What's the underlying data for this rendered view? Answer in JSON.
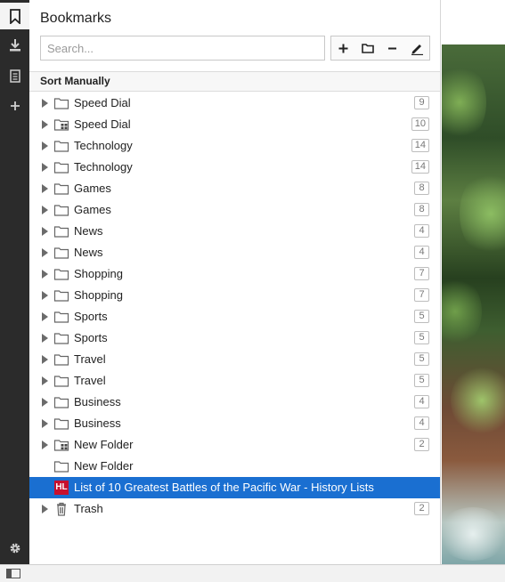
{
  "panel": {
    "title": "Bookmarks",
    "search_placeholder": "Search...",
    "sort_label": "Sort Manually"
  },
  "toolbar": {
    "add": "+",
    "minus": "−"
  },
  "strip": {
    "icons": [
      "bookmark-icon",
      "download-icon",
      "notes-icon",
      "add-panel-icon",
      "settings-icon"
    ]
  },
  "items": [
    {
      "label": "Speed Dial",
      "count": "9",
      "type": "folder"
    },
    {
      "label": "Speed Dial",
      "count": "10",
      "type": "speeddial"
    },
    {
      "label": "Technology",
      "count": "14",
      "type": "folder"
    },
    {
      "label": "Technology",
      "count": "14",
      "type": "folder"
    },
    {
      "label": "Games",
      "count": "8",
      "type": "folder"
    },
    {
      "label": "Games",
      "count": "8",
      "type": "folder"
    },
    {
      "label": "News",
      "count": "4",
      "type": "folder"
    },
    {
      "label": "News",
      "count": "4",
      "type": "folder"
    },
    {
      "label": "Shopping",
      "count": "7",
      "type": "folder"
    },
    {
      "label": "Shopping",
      "count": "7",
      "type": "folder"
    },
    {
      "label": "Sports",
      "count": "5",
      "type": "folder"
    },
    {
      "label": "Sports",
      "count": "5",
      "type": "folder"
    },
    {
      "label": "Travel",
      "count": "5",
      "type": "folder"
    },
    {
      "label": "Travel",
      "count": "5",
      "type": "folder"
    },
    {
      "label": "Business",
      "count": "4",
      "type": "folder"
    },
    {
      "label": "Business",
      "count": "4",
      "type": "folder"
    },
    {
      "label": "New Folder",
      "count": "2",
      "type": "speeddial"
    },
    {
      "label": "New Folder",
      "count": "",
      "type": "folder-empty"
    },
    {
      "label": "List of 10 Greatest Battles of the Pacific War - History Lists",
      "count": "",
      "type": "bookmark",
      "favicon": "HL",
      "selected": true
    },
    {
      "label": "Trash",
      "count": "2",
      "type": "trash"
    }
  ],
  "colors": {
    "selection": "#1a6fd1",
    "strip": "#2b2b2b",
    "favicon": "#c8102e"
  }
}
